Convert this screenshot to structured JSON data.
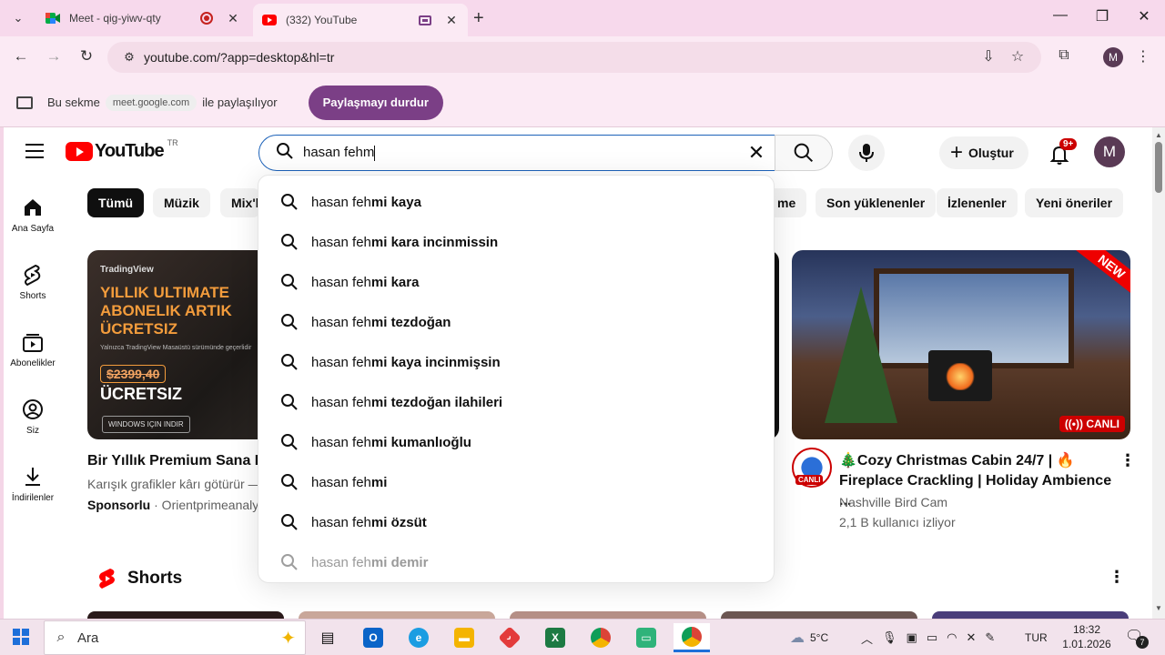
{
  "browser": {
    "tabs": [
      {
        "title": "Meet - qig-yiwv-qty",
        "active": false
      },
      {
        "title": "(332) YouTube",
        "active": true
      }
    ],
    "url": "youtube.com/?app=desktop&hl=tr",
    "profile_initial": "M",
    "share_bar": {
      "text_before": "Bu sekme",
      "site": "meet.google.com",
      "text_after": "ile paylaşılıyor",
      "stop_button": "Paylaşmayı durdur"
    }
  },
  "youtube": {
    "logo_text": "YouTube",
    "country_code": "TR",
    "search": {
      "query": "hasan fehm"
    },
    "create_label": "Oluştur",
    "notification_badge": "9+",
    "avatar_initial": "M",
    "sidebar": [
      {
        "label": "Ana Sayfa",
        "icon": "home-icon"
      },
      {
        "label": "Shorts",
        "icon": "shorts-icon"
      },
      {
        "label": "Abonelikler",
        "icon": "subscriptions-icon"
      },
      {
        "label": "Siz",
        "icon": "you-icon"
      },
      {
        "label": "İndirilenler",
        "icon": "download-icon"
      }
    ],
    "chips": [
      "Tümü",
      "Müzik",
      "Mix'l",
      "me",
      "Son yüklenenler",
      "İzlenenler",
      "Yeni öneriler"
    ],
    "ad": {
      "brand": "TradingView",
      "headline": "YILLIK ULTIMATE ABONELIK ARTIK ÜCRETSIZ",
      "subtext": "Yalnızca TradingView Masaüstü sürümünde geçerlidir",
      "old_price": "$2399,40",
      "free_text": "ÜCRETSIZ",
      "windows_button": "WINDOWS IÇIN INDIR",
      "title": "Bir Yıllık Premium Sana Be",
      "description": "Karışık grafikler kârı götürür —",
      "sponsored_label": "Sponsorlu",
      "sponsor": "· Orientprimeanalyt"
    },
    "live_video": {
      "badge_new": "NEW",
      "badge_live": "((•)) CANLI",
      "channel_live": "CANLI",
      "title": "🎄Cozy Christmas Cabin 24/7 | 🔥 Fireplace Crackling | Holiday Ambience ...",
      "channel": "Nashville Bird Cam",
      "viewers": "2,1 B kullanıcı izliyor"
    },
    "shorts_title": "Shorts",
    "suggestions": [
      {
        "typed": "hasan feh",
        "rest": "mi kaya"
      },
      {
        "typed": "hasan feh",
        "rest": "mi kara incinmissin"
      },
      {
        "typed": "hasan feh",
        "rest": "mi kara"
      },
      {
        "typed": "hasan feh",
        "rest": "mi tezdoğan"
      },
      {
        "typed": "hasan feh",
        "rest": "mi kaya incinmişsin"
      },
      {
        "typed": "hasan feh",
        "rest": "mi tezdoğan ilahileri"
      },
      {
        "typed": "hasan feh",
        "rest": "mi kumanlıoğlu"
      },
      {
        "typed": "hasan feh",
        "rest": "mi"
      },
      {
        "typed": "hasan feh",
        "rest": "mi özsüt"
      },
      {
        "typed": "hasan feh",
        "rest": "mi demir"
      }
    ]
  },
  "taskbar": {
    "search_placeholder": "Ara",
    "weather": "5°C",
    "language": "TUR",
    "time": "18:32",
    "date": "1.01.2026",
    "notification_count": "7"
  },
  "colors": {
    "chrome_pink": "#f7d9ec",
    "share_button": "#7b3f86",
    "youtube_red": "#ff0000",
    "search_focus": "#1c62b9"
  }
}
